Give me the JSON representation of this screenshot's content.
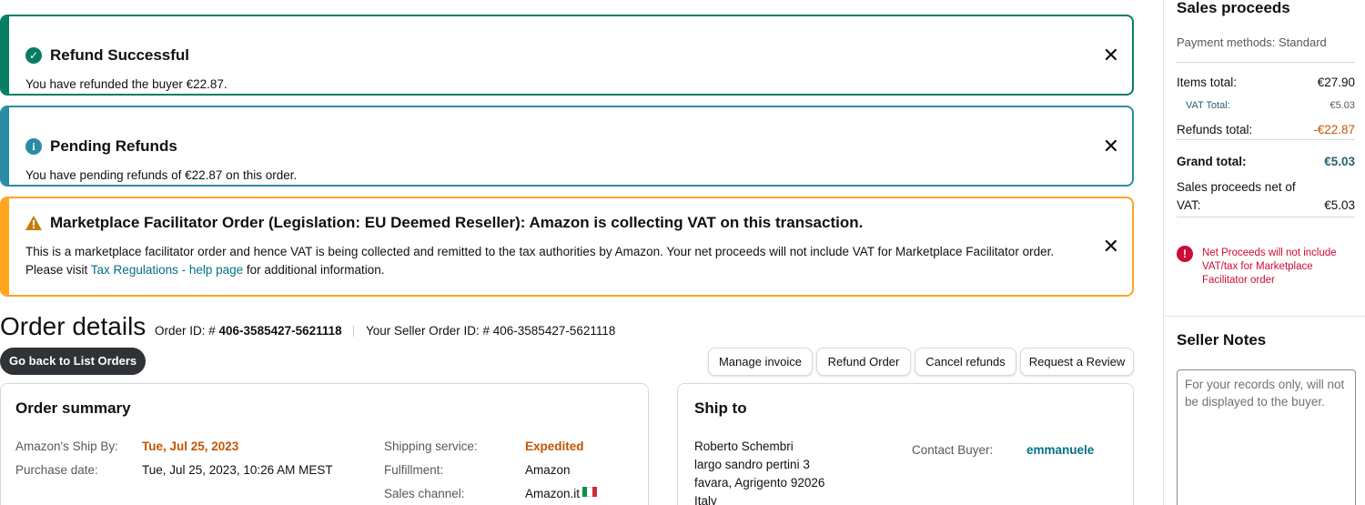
{
  "alerts": {
    "refund_success": {
      "title": "Refund Successful",
      "body": "You have refunded the buyer €22.87.",
      "icon": "check-circle-icon",
      "color": "#067d62"
    },
    "pending": {
      "title": "Pending Refunds",
      "body": "You have pending refunds of €22.87 on this order.",
      "icon": "info-circle-icon",
      "color": "#2a8ba5"
    },
    "facilitator": {
      "title": "Marketplace Facilitator Order (Legislation: EU Deemed Reseller): Amazon is collecting VAT on this transaction.",
      "body_1": "This is a marketplace facilitator order and hence VAT is being collected and remitted to the tax authorities by Amazon. Your net proceeds will not include VAT for Marketplace Facilitator order. Please visit ",
      "link": "Tax Regulations - help page",
      "body_2": " for additional information.",
      "icon": "warning-triangle-icon",
      "color": "#ffa41c"
    },
    "close_glyph": "✕"
  },
  "order": {
    "title": "Order details",
    "order_id_label": "Order ID: # ",
    "order_id": "406-3585427-5621118",
    "seller_order_label": "Your Seller Order ID: # 406-3585427-5621118"
  },
  "buttons": {
    "back": "Go back to List Orders",
    "manage_invoice": "Manage invoice",
    "refund_order": "Refund Order",
    "cancel_refunds": "Cancel refunds",
    "request_review": "Request a Review"
  },
  "summary": {
    "title": "Order summary",
    "ship_by_label": "Amazon's Ship By:",
    "ship_by": "Tue, Jul 25, 2023",
    "purchase_label": "Purchase date:",
    "purchase": "Tue, Jul 25, 2023, 10:26 AM MEST",
    "shipping_service_label": "Shipping service:",
    "shipping_service": "Expedited",
    "fulfillment_label": "Fulfillment:",
    "fulfillment": "Amazon",
    "sales_channel_label": "Sales channel:",
    "sales_channel": "Amazon.it"
  },
  "ship_to": {
    "title": "Ship to",
    "name": "Roberto Schembri",
    "line1": "largo sandro pertini 3",
    "line2": "favara, Agrigento 92026",
    "country": "Italy",
    "contact_label": "Contact Buyer:",
    "contact": "emmanuele"
  },
  "proceeds": {
    "title": "Sales proceeds",
    "payment_methods": "Payment methods: Standard",
    "items_label": "Items total:",
    "items": "€27.90",
    "vat_label": "VAT Total:",
    "vat": "€5.03",
    "refunds_label": "Refunds total:",
    "refunds": "-€22.87",
    "grand_label": "Grand total:",
    "grand": "€5.03",
    "net_label_1": "Sales proceeds net of",
    "net_label_2": "VAT:",
    "net": "€5.03",
    "note": "Net Proceeds will not include VAT/tax for Marketplace Facilitator order"
  },
  "seller_notes": {
    "title": "Seller Notes",
    "placeholder": "For your records only, will not be displayed to the buyer."
  }
}
